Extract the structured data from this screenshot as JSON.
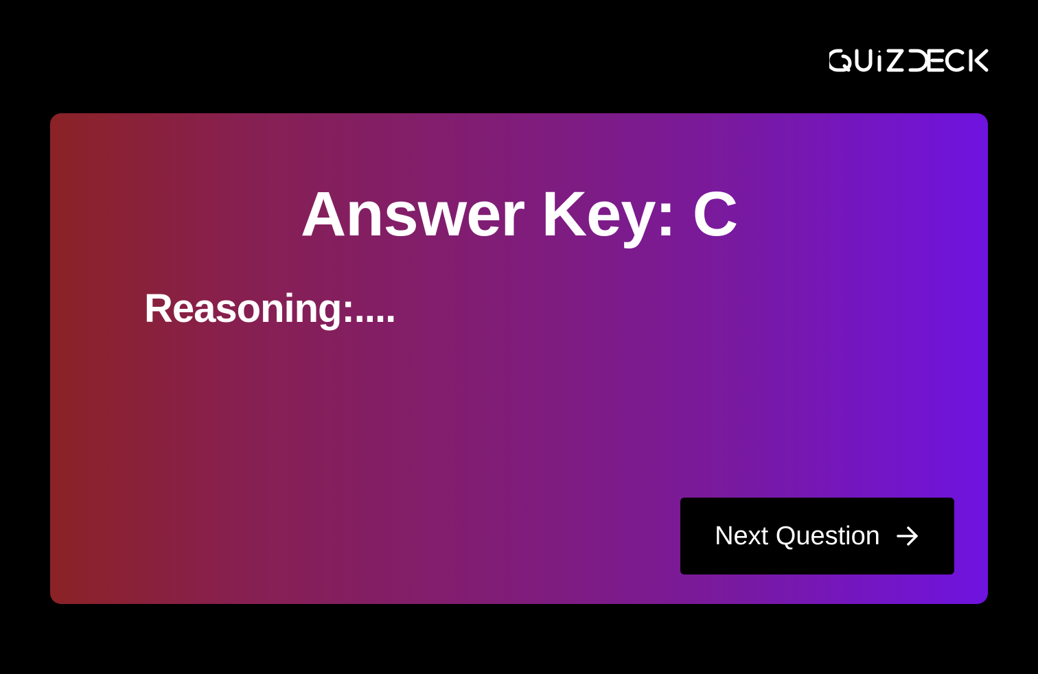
{
  "brand": {
    "logo_text": "QUIZDECK"
  },
  "card": {
    "title": "Answer Key: C",
    "reasoning": "Reasoning:....",
    "next_button_label": "Next Question",
    "next_button_icon": "arrow-right-icon"
  },
  "colors": {
    "background": "#000000",
    "gradient_start": "#8b2226",
    "gradient_end": "#6f13e0",
    "button_background": "#000000",
    "text": "#ffffff"
  }
}
